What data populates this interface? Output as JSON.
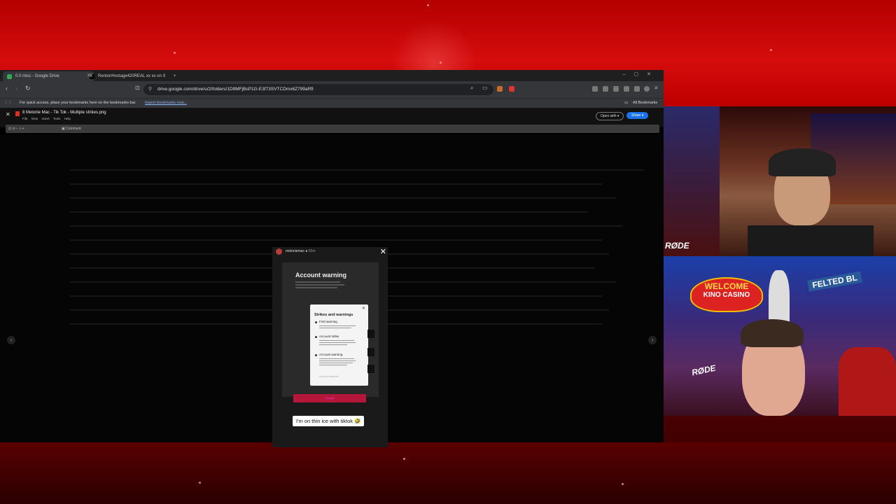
{
  "tabs": [
    {
      "label": "0.0 misc - Google Drive",
      "active": true
    },
    {
      "label": "RentonHostage420REAL xx xx on X"
    }
  ],
  "toolbar": {
    "url": "drive.google.com/drive/u/2/folders/1D9MFjBsP1G-E3f73SVTCDmx6Z799aRfl"
  },
  "bookmarks_bar": {
    "message": "For quick access, place your bookmarks here on the bookmarks bar.",
    "import_link": "Import bookmarks now...",
    "all_bookmarks": "All Bookmarks"
  },
  "drive_viewer": {
    "file_title": "8 Melonie Mac - Tik Tok - Multiple strikes.png",
    "menu": "File View Insert Tools Help",
    "open_with": "Open with",
    "share": "Share",
    "comment": "Comment"
  },
  "preview": {
    "username": "meloniemac",
    "time": "55m",
    "heading": "Account warning",
    "modal_title": "Strikes and warnings",
    "strikes": [
      "First warning",
      "Account strike",
      "Account warning"
    ],
    "footer": "Account banned",
    "appeal": "Appeal",
    "caption": "I'm on thin ice with tiktok 🤣"
  },
  "stream": {
    "welcome_line1": "WELCOME",
    "welcome_line2": "KINO CASINO",
    "felted_sign": "FELTED BL",
    "mic_brand": "RØDE"
  },
  "colors": {
    "share_blue": "#1a73e8",
    "appeal_red": "#b5173a",
    "stream_red": "#c00000"
  }
}
